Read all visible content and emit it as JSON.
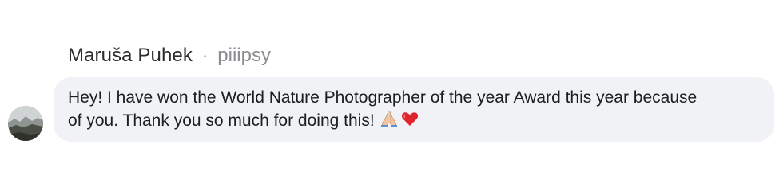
{
  "message": {
    "sender_name": "Maruša Puhek",
    "separator": "·",
    "sender_handle": "piiipsy",
    "text_line_1": "Hey! I have won the World Nature Photographer of the year Award this year because",
    "text_line_2": "of you. Thank you so much for doing this!",
    "emojis": [
      "praying-hands-icon",
      "red-heart-icon"
    ]
  },
  "colors": {
    "bubble_background": "#f0f2f5",
    "text": "#1c1e21",
    "secondary_text": "#8a8d91",
    "heart": "#e0242e"
  }
}
